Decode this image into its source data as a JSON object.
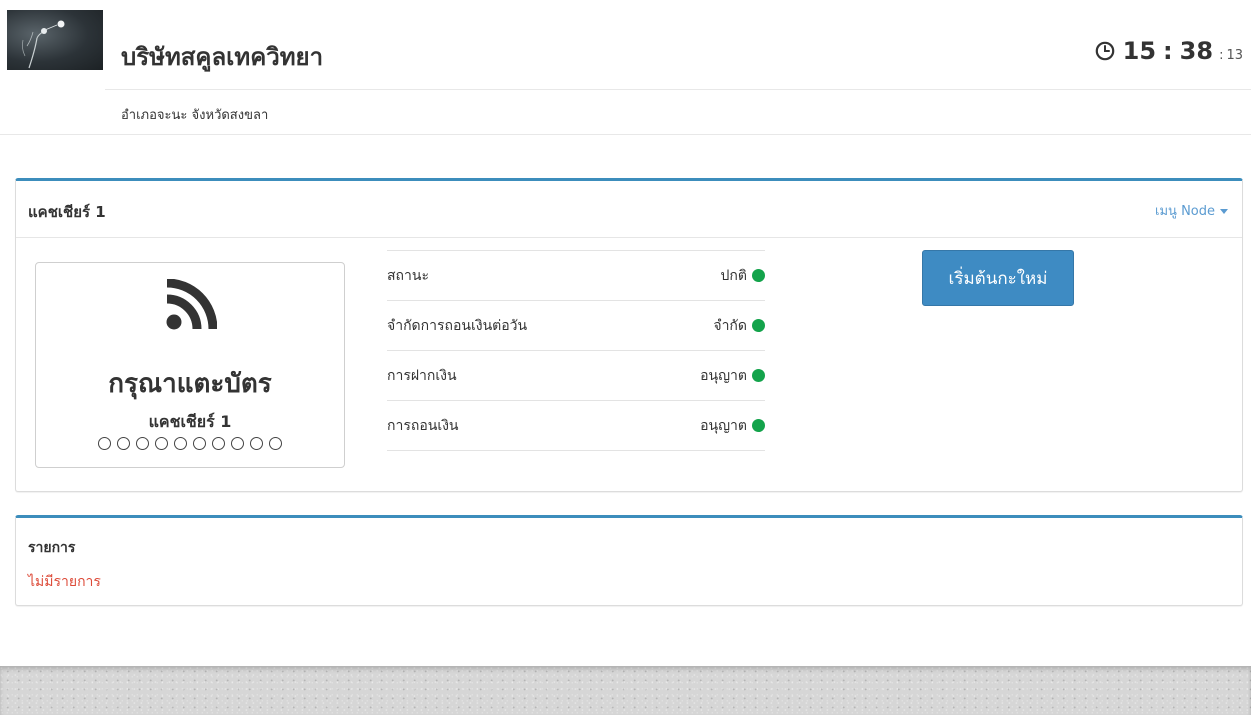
{
  "header": {
    "company_name": "บริษัทสคูลเทควิทยา",
    "address": "อำเภอจะนะ จังหวัดสงขลา",
    "clock": {
      "hours": "15",
      "minutes": "38",
      "seconds": "13",
      "separator": ":"
    }
  },
  "cashier_panel": {
    "title": "แคชเชียร์ 1",
    "menu_label": "เมนู Node",
    "card_box": {
      "icon": "rss-icon",
      "prompt": "กรุณาแตะบัตร",
      "cashier_name": "แคชเชียร์ 1",
      "dots_count": 10
    },
    "status_rows": [
      {
        "label": "สถานะ",
        "value": "ปกติ",
        "color": "#13a34b"
      },
      {
        "label": "จำกัดการถอนเงินต่อวัน",
        "value": "จำกัด",
        "color": "#13a34b"
      },
      {
        "label": "การฝากเงิน",
        "value": "อนุญาต",
        "color": "#13a34b"
      },
      {
        "label": "การถอนเงิน",
        "value": "อนุญาต",
        "color": "#13a34b"
      }
    ],
    "restart_button": "เริ่มต้นกะใหม่"
  },
  "list_panel": {
    "title": "รายการ",
    "empty_text": "ไม่มีรายการ"
  },
  "colors": {
    "accent": "#3c8dbc",
    "button": "#3e8bc3",
    "status_ok": "#13a34b",
    "empty": "#dd4b39"
  }
}
